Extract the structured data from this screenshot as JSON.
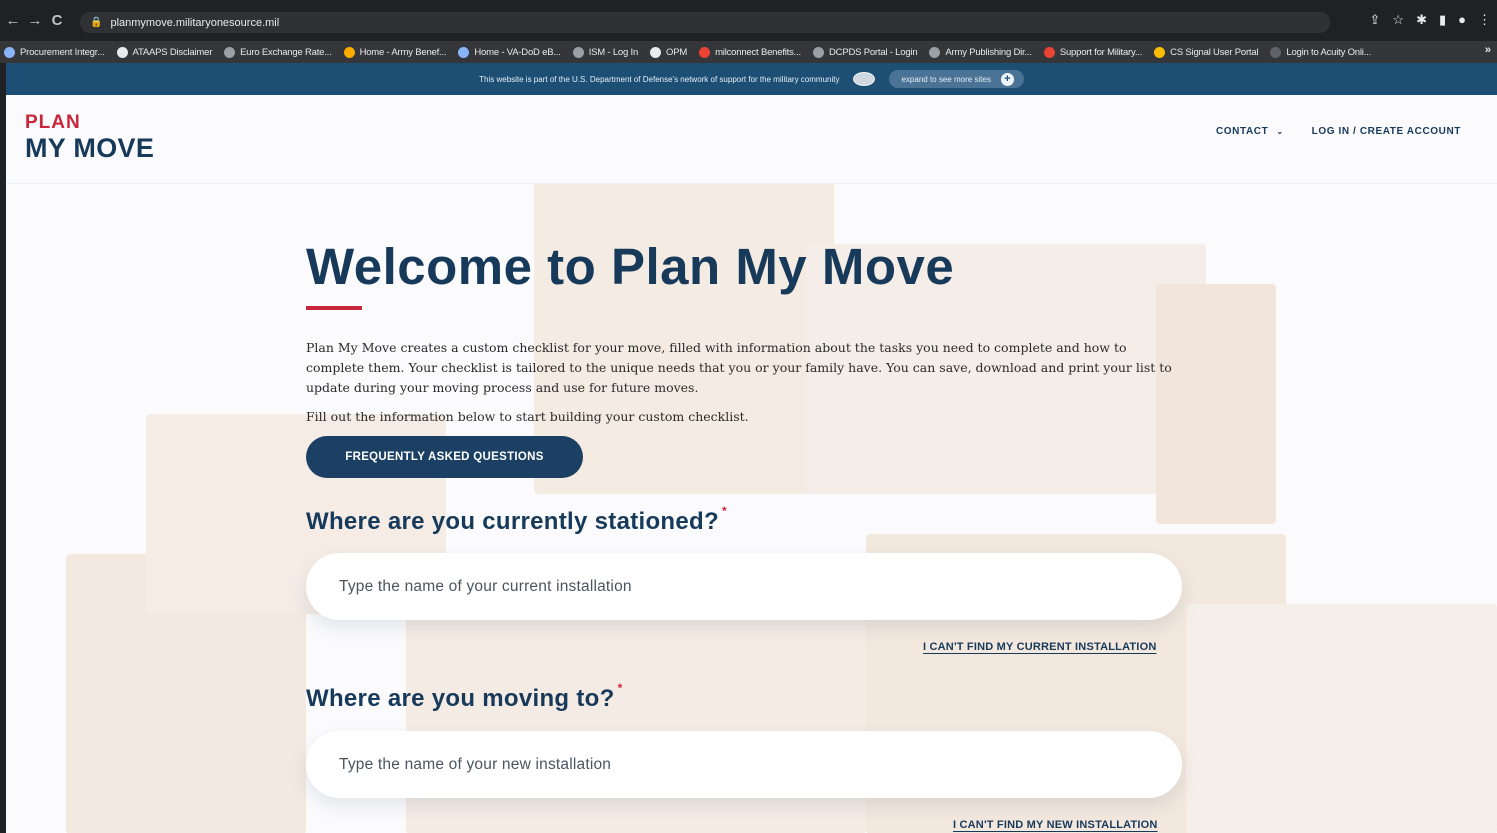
{
  "browser": {
    "url": "planmymove.militaryonesource.mil",
    "bookmarks": [
      {
        "label": "Procurement Integr...",
        "color": "#8ab4f8"
      },
      {
        "label": "ATAAPS Disclaimer",
        "color": "#e8eaed"
      },
      {
        "label": "Euro Exchange Rate...",
        "color": "#9aa0a6"
      },
      {
        "label": "Home - Army Benef...",
        "color": "#f9ab00"
      },
      {
        "label": "Home - VA-DoD eB...",
        "color": "#8ab4f8"
      },
      {
        "label": "ISM - Log In",
        "color": "#9aa0a6"
      },
      {
        "label": "OPM",
        "color": "#e8eaed"
      },
      {
        "label": "milconnect Benefits...",
        "color": "#ea4335"
      },
      {
        "label": "DCPDS Portal - Login",
        "color": "#9aa0a6"
      },
      {
        "label": "Army Publishing Dir...",
        "color": "#9aa0a6"
      },
      {
        "label": "Support for Military...",
        "color": "#ea4335"
      },
      {
        "label": "CS Signal User Portal",
        "color": "#fbbc04"
      },
      {
        "label": "Login to Acuity Onli...",
        "color": "#5f6368"
      }
    ],
    "more": "»"
  },
  "banner": {
    "text": "This website is part of the U.S. Department of Defense's network of support for the military community",
    "expand_label": "expand to see more sites",
    "plus": "+"
  },
  "header": {
    "logo_line1": "PLAN",
    "logo_line2": "MY MOVE",
    "nav_contact": "CONTACT",
    "nav_login": "LOG IN / CREATE ACCOUNT"
  },
  "main": {
    "title": "Welcome to Plan My Move",
    "intro": "Plan My Move creates a custom checklist for your move, filled with information about the tasks you need to complete and how to complete them. Your checklist is tailored to the unique needs that you or your family have. You can save, download and print your list to update during your moving process and use for future moves.",
    "intro2": "Fill out the information below to start building your custom checklist.",
    "faq_button": "FREQUENTLY ASKED QUESTIONS",
    "q1": "Where are you currently stationed?",
    "q1_placeholder": "Type the name of your current installation",
    "q1_link": "I CAN'T FIND MY CURRENT INSTALLATION",
    "q2": "Where are you moving to?",
    "q2_placeholder": "Type the name of your new installation",
    "q2_link": "I CAN'T FIND MY NEW INSTALLATION",
    "required_mark": "*"
  }
}
